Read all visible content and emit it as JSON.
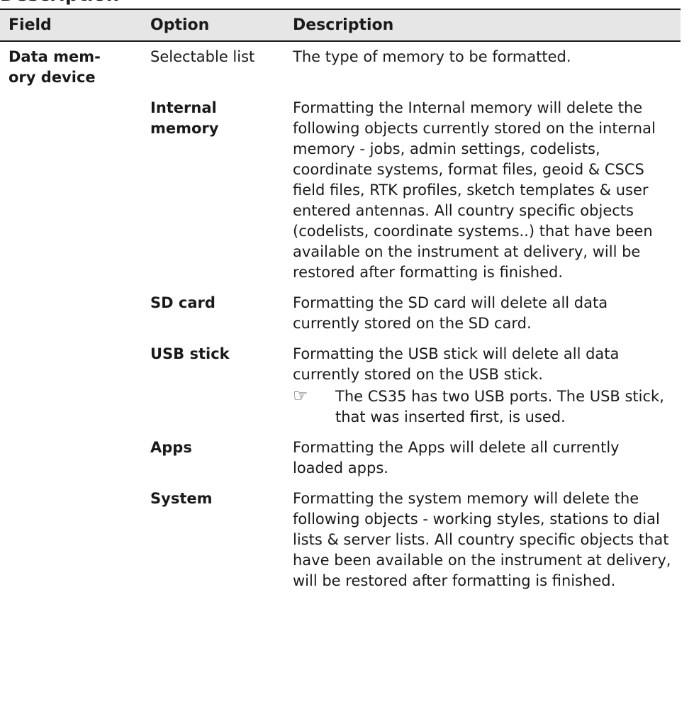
{
  "section_title": "Description",
  "table": {
    "headers": [
      "Field",
      "Option",
      "Description"
    ],
    "field": "Data memory device",
    "field_display": "Data mem-\nory device",
    "rows": [
      {
        "option": "Selectable list",
        "description": "The type of memory to be formatted."
      },
      {
        "option": "Internal memory",
        "description": "Formatting the Internal memory will delete the following objects currently stored on the internal memory - jobs, admin settings, codelists, coordinate systems, format files, geoid & CSCS field files, RTK profiles, sketch templates & user entered antennas. All country specific objects (codelists, coordinate systems..) that have been available on the instrument at delivery, will be restored after formatting is finished."
      },
      {
        "option": "SD card",
        "description": "Formatting the SD card will delete all data currently stored on the SD card."
      },
      {
        "option": "USB stick",
        "description": "Formatting the USB stick will delete all data currently stored on the USB stick.",
        "note": "The CS35 has two USB ports. The USB stick, that was inserted first, is used.",
        "note_icon": "pointing-hand-icon"
      },
      {
        "option": "Apps",
        "description": "Formatting the Apps will delete all currently loaded apps."
      },
      {
        "option": "System",
        "description": "Formatting the system memory will delete the following objects - working styles, stations to dial lists & server lists. All country specific objects that have been available on the instrument at delivery, will be restored after formatting is finished."
      }
    ]
  }
}
